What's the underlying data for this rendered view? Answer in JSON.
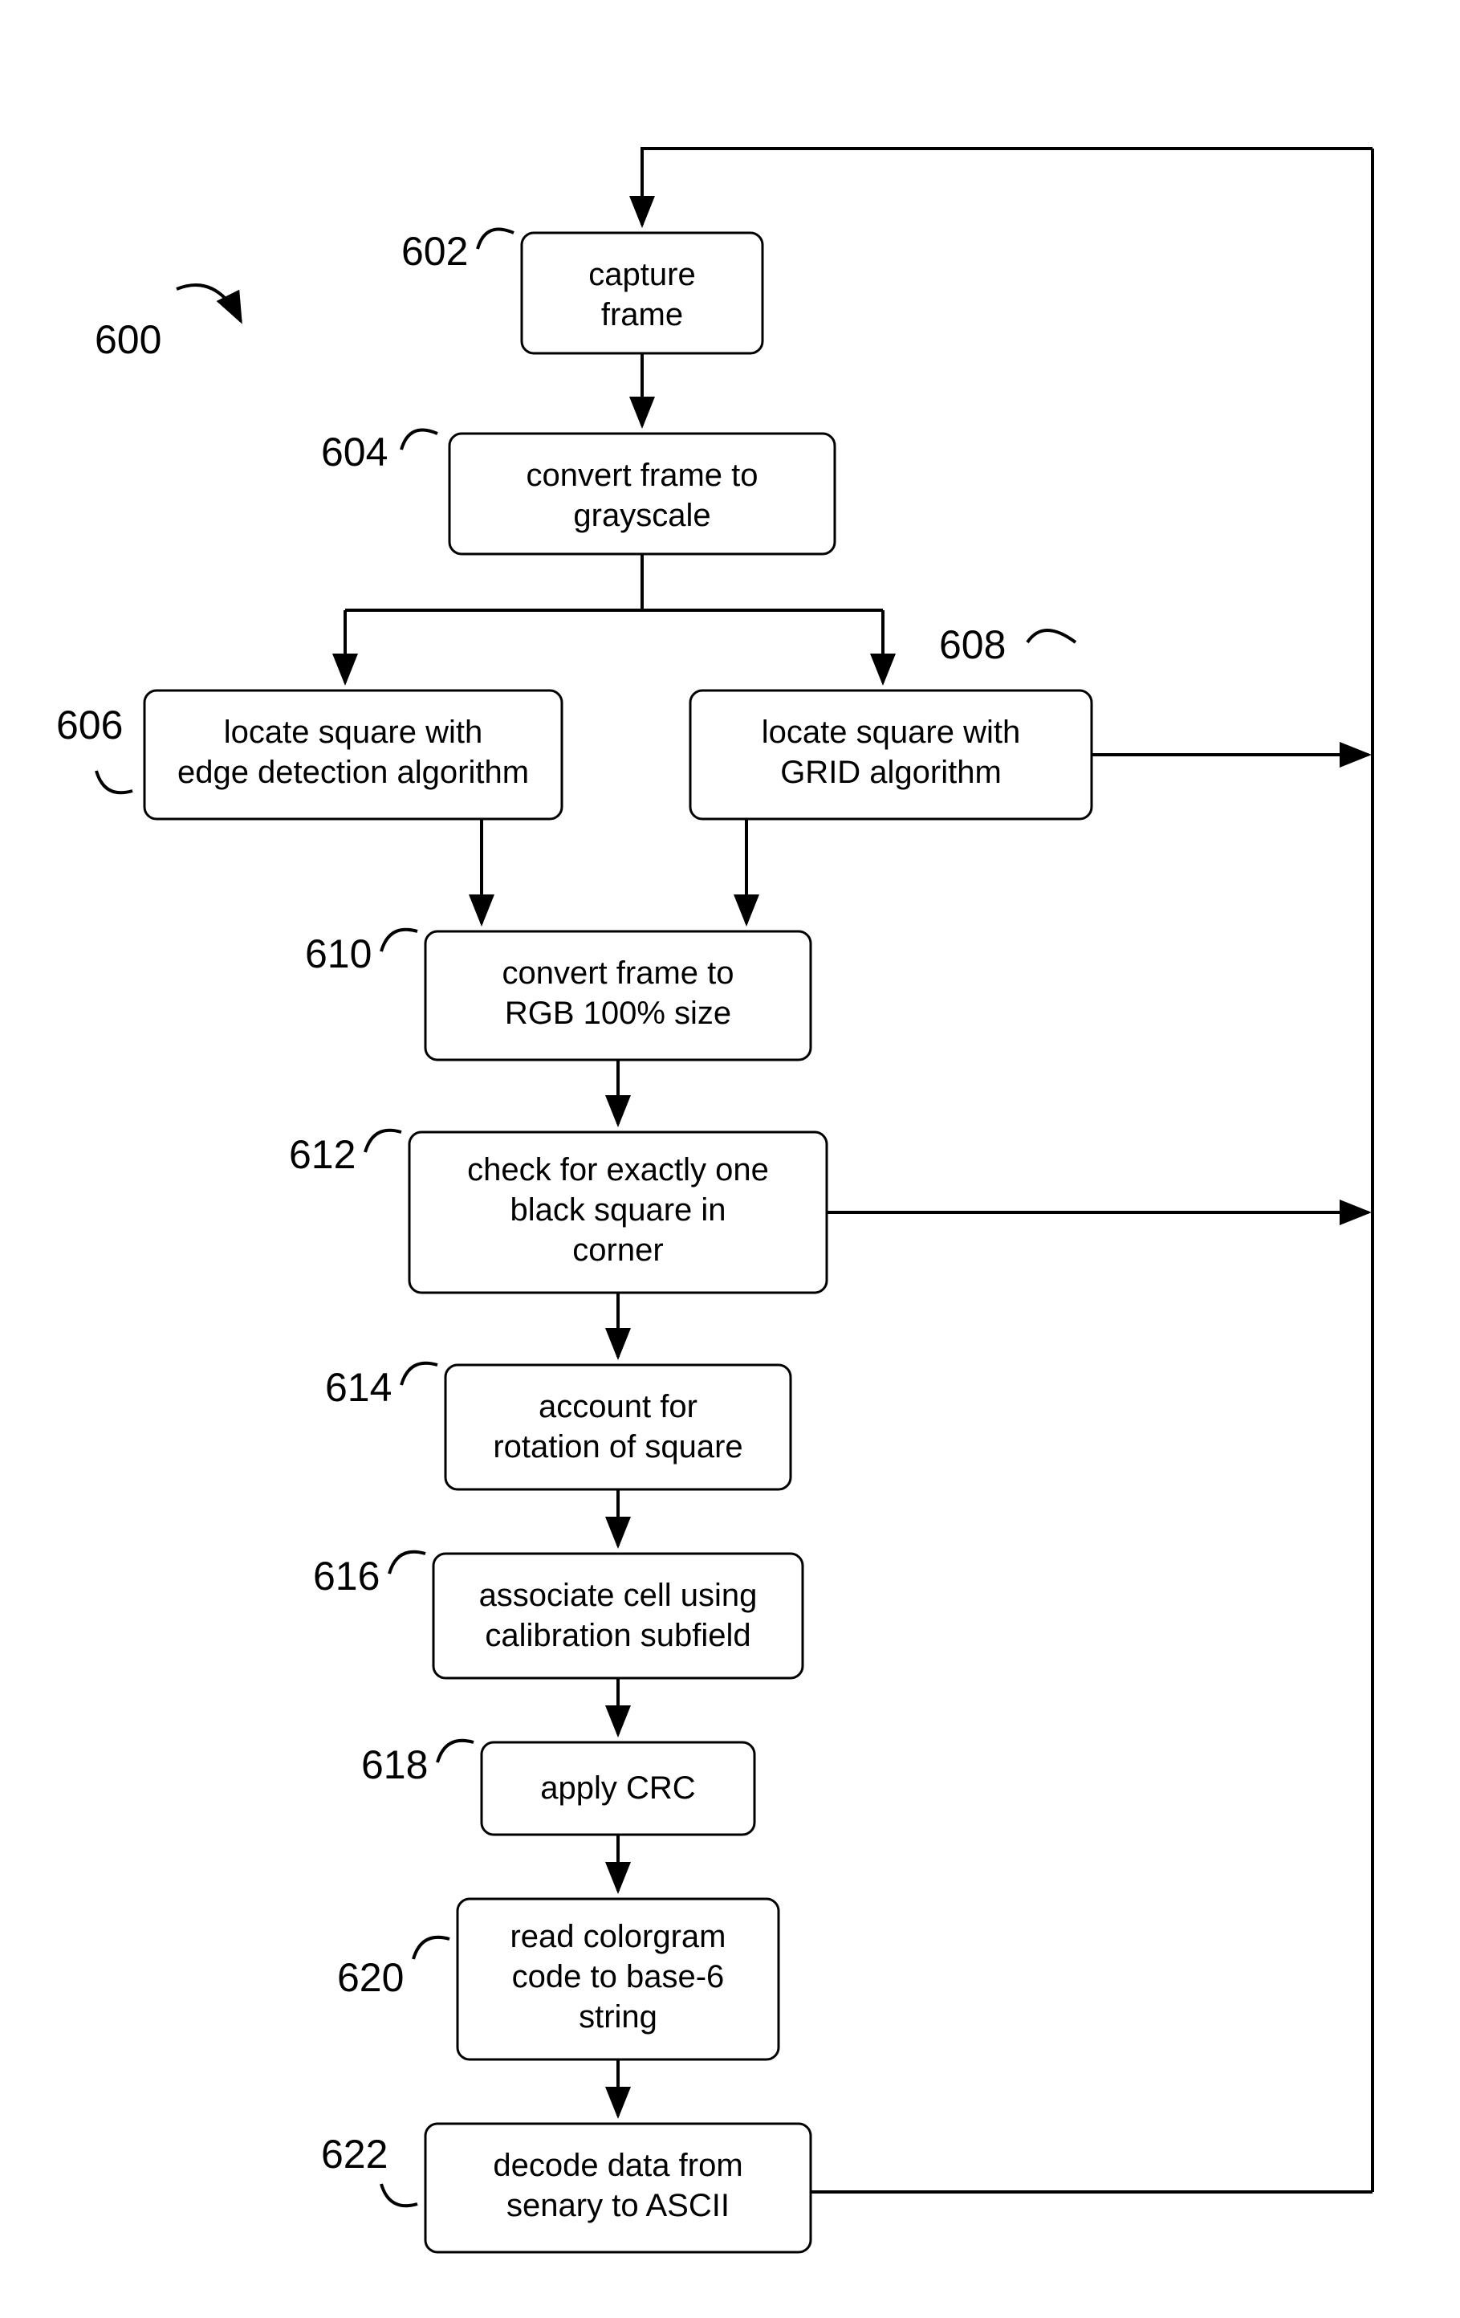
{
  "diagram_ref": "600",
  "nodes": {
    "n602": {
      "ref": "602",
      "lines": [
        "capture",
        "frame"
      ]
    },
    "n604": {
      "ref": "604",
      "lines": [
        "convert frame to",
        "grayscale"
      ]
    },
    "n606": {
      "ref": "606",
      "lines": [
        "locate square with",
        "edge detection algorithm"
      ]
    },
    "n608": {
      "ref": "608",
      "lines": [
        "locate square with",
        "GRID algorithm"
      ]
    },
    "n610": {
      "ref": "610",
      "lines": [
        "convert frame to",
        "RGB 100% size"
      ]
    },
    "n612": {
      "ref": "612",
      "lines": [
        "check for exactly one",
        "black square in",
        "corner"
      ]
    },
    "n614": {
      "ref": "614",
      "lines": [
        "account for",
        "rotation of square"
      ]
    },
    "n616": {
      "ref": "616",
      "lines": [
        "associate cell using",
        "calibration subfield"
      ]
    },
    "n618": {
      "ref": "618",
      "lines": [
        "apply CRC"
      ]
    },
    "n620": {
      "ref": "620",
      "lines": [
        "read colorgram",
        "code to base-6",
        "string"
      ]
    },
    "n622": {
      "ref": "622",
      "lines": [
        "decode data  from",
        "senary to ASCII"
      ]
    }
  }
}
